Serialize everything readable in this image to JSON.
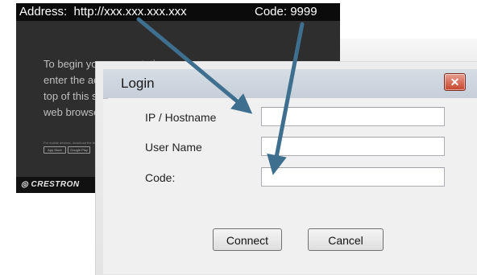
{
  "screen": {
    "address_label": "Address:",
    "address_value": "http://xxx.xxx.xxx.xxx",
    "code_label": "Code:",
    "code_value": "9999",
    "instructions": [
      "To begin your presentation",
      "enter the add",
      "top of this sc",
      "web browser."
    ],
    "mobile_note": "For mobile devices, download the free AirMedia app",
    "store_badges": [
      "App Store",
      "Google Play"
    ],
    "brand": "CRESTRON"
  },
  "dialog": {
    "title": "Login",
    "close_glyph": "✕",
    "fields": {
      "host_label": "IP / Hostname",
      "host_value": "",
      "user_label": "User Name",
      "user_value": "",
      "code_label": "Code:",
      "code_value": ""
    },
    "buttons": {
      "connect": "Connect",
      "cancel": "Cancel"
    }
  },
  "colors": {
    "arrow": "#3e6f8f",
    "screen_bg": "#2e2e2e",
    "close_button": "#c6452d"
  }
}
